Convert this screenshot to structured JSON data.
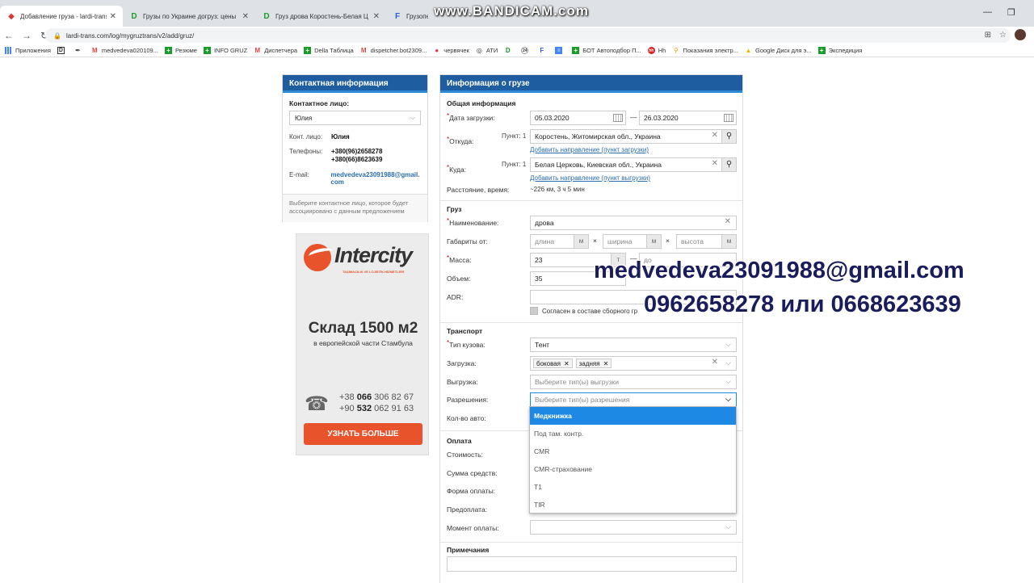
{
  "browser": {
    "tabs": [
      {
        "title": "Добавление груза - lardi-trans.c",
        "icon": "lardi-icon",
        "active": true
      },
      {
        "title": "Грузы по Украине догруз: цены",
        "icon": "d-icon"
      },
      {
        "title": "Груз дрова Коростень-Белая Ц",
        "icon": "d-icon"
      },
      {
        "title": "Грузопе",
        "icon": "f-icon"
      }
    ],
    "watermark": "www.BANDICAM.com",
    "url": "lardi-trans.com/log/mygruztrans/v2/add/gruz/",
    "bookmarks": [
      {
        "label": "Приложения",
        "icon": "apps-grid-icon"
      },
      {
        "label": "",
        "icon": "d-icon"
      },
      {
        "label": "",
        "icon": "feather-icon"
      },
      {
        "label": "medvedeva020109...",
        "icon": "gmail-icon"
      },
      {
        "label": "Резюме",
        "icon": "sheets-icon"
      },
      {
        "label": "INFO GRUZ",
        "icon": "sheets-icon"
      },
      {
        "label": "Диспетчера",
        "icon": "gmail-icon"
      },
      {
        "label": "Della Таблица",
        "icon": "sheets-icon"
      },
      {
        "label": "dispetcher.bot2309...",
        "icon": "gmail-icon"
      },
      {
        "label": "червячек",
        "icon": "chrome-icon"
      },
      {
        "label": "АТИ",
        "icon": "ati-icon"
      },
      {
        "label": "",
        "icon": "d-icon"
      },
      {
        "label": "",
        "icon": "24-icon"
      },
      {
        "label": "",
        "icon": "f-icon"
      },
      {
        "label": "",
        "icon": "docs-icon"
      },
      {
        "label": "БОТ Автоподбор П...",
        "icon": "sheets-icon"
      },
      {
        "label": "Hh",
        "icon": "hh-icon"
      },
      {
        "label": "Показания электр...",
        "icon": "pin-icon"
      },
      {
        "label": "Google Диск для э...",
        "icon": "drive-icon"
      },
      {
        "label": "Экспедиция",
        "icon": "sheets-icon"
      }
    ]
  },
  "contact": {
    "header": "Контактная информация",
    "person_label": "Контактное лицо:",
    "person_value": "Юлия",
    "name_key": "Конт. лицо:",
    "name_val": "Юлия",
    "phones_key": "Телефоны:",
    "phone1": "+380(96)2658278",
    "phone2": "+380(66)8623639",
    "email_key": "E-mail:",
    "email_val": "medvedeva23091988@gmail.com",
    "note": "Выберите контактное лицо, которое будет ассоциировано с данным предложением"
  },
  "ad": {
    "brand": "Intercity",
    "tagline": "TAŞIMACILIK VE LOJİSTİK HİZMETLERİ",
    "headline": "Склад 1500 м2",
    "subline": "в европейской части Стамбула",
    "phone1_prefix": "+38 ",
    "phone1_code": "066",
    "phone1_rest": " 306 82 67",
    "phone2_prefix": "+90 ",
    "phone2_code": "532",
    "phone2_rest": " 062 91 63",
    "button": "УЗНАТЬ БОЛЬШЕ"
  },
  "cargo": {
    "header": "Информация о грузе",
    "general": {
      "title": "Общая информация",
      "date_label": "Дата загрузки:",
      "date_from": "05.03.2020",
      "date_sep": "—",
      "date_to": "26.03.2020",
      "from_label": "Откуда:",
      "point1": "Пункт: 1",
      "from_value": "Коростень, Житомирская обл., Украина",
      "add_load": "Добавить направление (пункт загрузки)",
      "to_label": "Куда:",
      "point2": "Пункт: 1",
      "to_value": "Белая Церковь, Киевская обл., Украина",
      "add_unload": "Добавить направление (пункт выгрузки)",
      "distance_label": "Расстояние, время:",
      "distance_value": "~226 км, 3 ч 5 мин"
    },
    "gruz": {
      "title": "Груз",
      "name_label": "Наименование:",
      "name_value": "дрова",
      "dims_label": "Габариты от:",
      "len_ph": "длина",
      "wid_ph": "ширина",
      "hei_ph": "высота",
      "unit_m": "м",
      "times": "×",
      "mass_label": "Масса:",
      "mass_value": "23",
      "unit_t": "т",
      "mass_to_ph": "до",
      "volume_label": "Объем:",
      "volume_value": "35",
      "adr_label": "ADR:",
      "combined_label": "Согласен в составе сборного гр"
    },
    "transport": {
      "title": "Транспорт",
      "body_label": "Тип кузова:",
      "body_value": "Тент",
      "load_label": "Загрузка:",
      "load_chips": [
        "боковая",
        "задняя"
      ],
      "unload_label": "Выгрузка:",
      "unload_ph": "Выберите тип(ы) выгрузки",
      "perm_label": "Разрешения:",
      "perm_ph": "Выберите тип(ы) разрешения",
      "count_label": "Кол-во авто:"
    },
    "payment": {
      "title": "Оплата",
      "cost_label": "Стоимость:",
      "sum_label": "Сумма средств:",
      "form_label": "Форма оплаты:",
      "prepay_label": "Предоплата:",
      "moment_label": "Момент оплаты:"
    },
    "notes": {
      "title": "Примечания"
    }
  },
  "permissions_dropdown": [
    "Медкнижка",
    "Под там. контр.",
    "CMR",
    "CMR-страхование",
    "T1",
    "TIR"
  ],
  "overlay": {
    "email": "medvedeva23091988@gmail.com",
    "phones": "0962658278 или 0668623639"
  },
  "colors": {
    "header_blue": "#1e5da0",
    "accent_orange": "#e8532b",
    "dropdown_highlight": "#1e88e5"
  }
}
